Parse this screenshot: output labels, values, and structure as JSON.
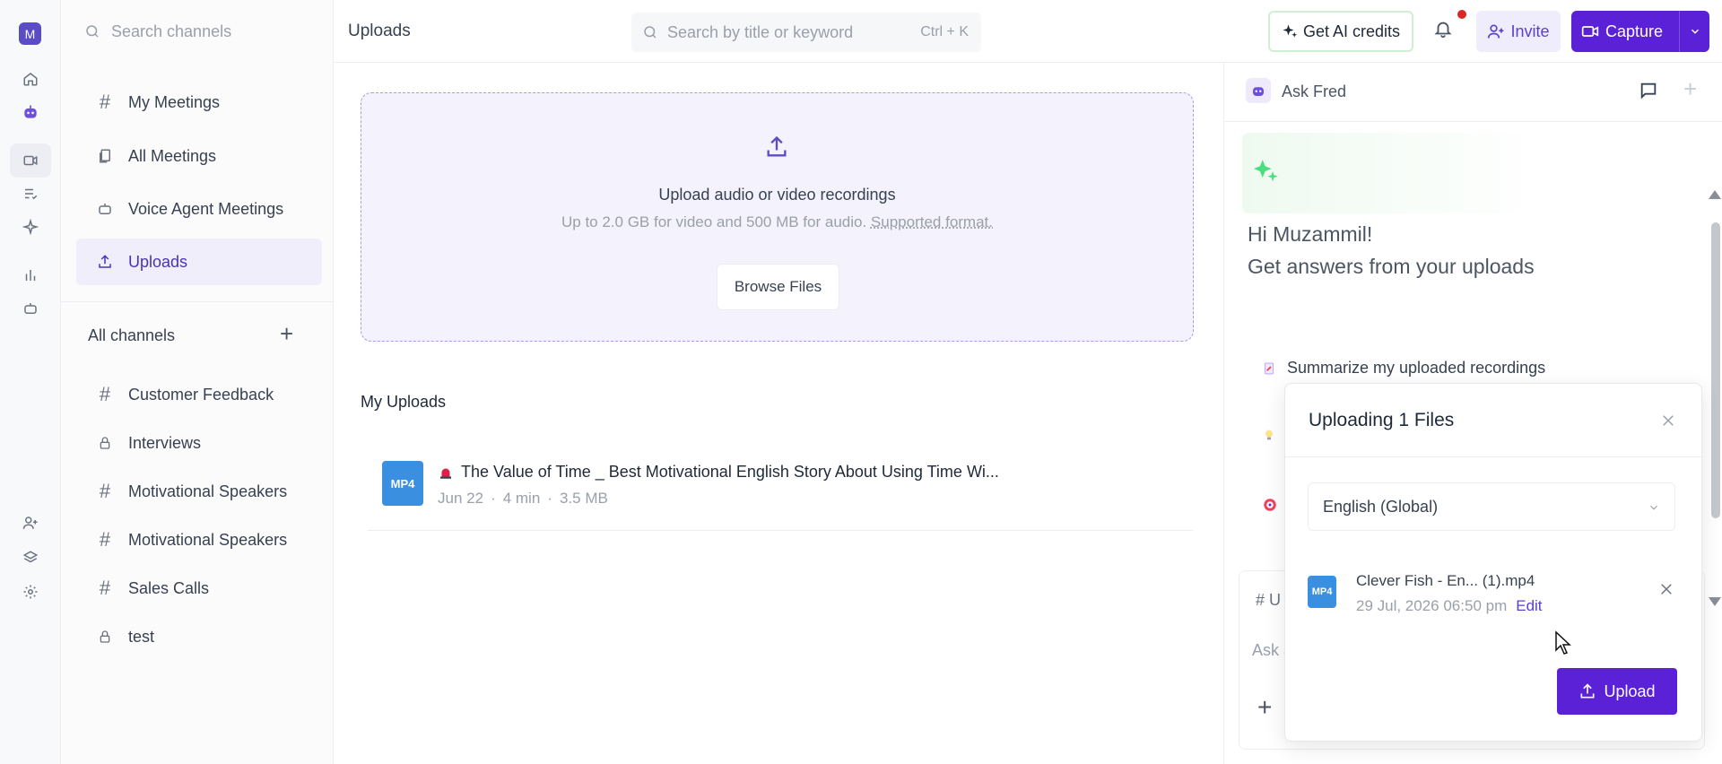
{
  "app": {
    "user_initial": "M",
    "accent": "#5a21d6"
  },
  "rail": {
    "items": [
      {
        "name": "home-icon"
      },
      {
        "name": "fred-bot-icon"
      },
      {
        "name": "video-icon"
      },
      {
        "name": "tasks-icon"
      },
      {
        "name": "sparkle-icon"
      },
      {
        "name": "analytics-icon"
      },
      {
        "name": "voice-agent-icon"
      },
      {
        "name": "add-user-icon"
      },
      {
        "name": "layers-icon"
      },
      {
        "name": "settings-icon"
      }
    ]
  },
  "sidebar": {
    "search_placeholder": "Search channels",
    "nav": [
      {
        "label": "My Meetings",
        "icon": "hash-icon"
      },
      {
        "label": "All Meetings",
        "icon": "meetings-icon"
      },
      {
        "label": "Voice Agent Meetings",
        "icon": "bot-icon"
      },
      {
        "label": "Uploads",
        "icon": "upload-icon",
        "active": true
      }
    ],
    "section_title": "All channels",
    "channels": [
      {
        "label": "Customer Feedback",
        "icon": "hash-icon"
      },
      {
        "label": "Interviews",
        "icon": "lock-icon"
      },
      {
        "label": "Motivational Speakers",
        "icon": "hash-icon"
      },
      {
        "label": "Motivational Speakers",
        "icon": "hash-icon"
      },
      {
        "label": "Sales Calls",
        "icon": "hash-icon"
      },
      {
        "label": "test",
        "icon": "lock-icon"
      }
    ]
  },
  "topbar": {
    "title": "Uploads",
    "search_placeholder": "Search by title or keyword",
    "search_shortcut": "Ctrl + K",
    "ai_credits_label": "Get AI credits",
    "invite_label": "Invite",
    "capture_label": "Capture"
  },
  "dropzone": {
    "title": "Upload audio or video recordings",
    "subtitle": "Up to 2.0 GB for video and 500 MB for audio.",
    "subtitle_link": "Supported format.",
    "browse_label": "Browse Files"
  },
  "uploads": {
    "heading": "My Uploads",
    "items": [
      {
        "badge": "MP4",
        "title": "The Value of Time _ Best Motivational English Story About Using Time Wi...",
        "date": "Jun 22",
        "duration": "4 min",
        "size": "3.5 MB"
      }
    ]
  },
  "assistant": {
    "title": "Ask Fred",
    "greeting": "Hi Muzammil!",
    "prompt": "Get answers from your uploads",
    "suggestion": "Summarize my uploaded recordings",
    "input_prefix": "# U",
    "input_placeholder": "Ask a"
  },
  "modal": {
    "title": "Uploading 1 Files",
    "language": "English (Global)",
    "file": {
      "badge": "MP4",
      "name": "Clever Fish - En... (1).mp4",
      "timestamp": "29 Jul, 2026 06:50 pm",
      "edit_label": "Edit"
    },
    "upload_label": "Upload"
  }
}
